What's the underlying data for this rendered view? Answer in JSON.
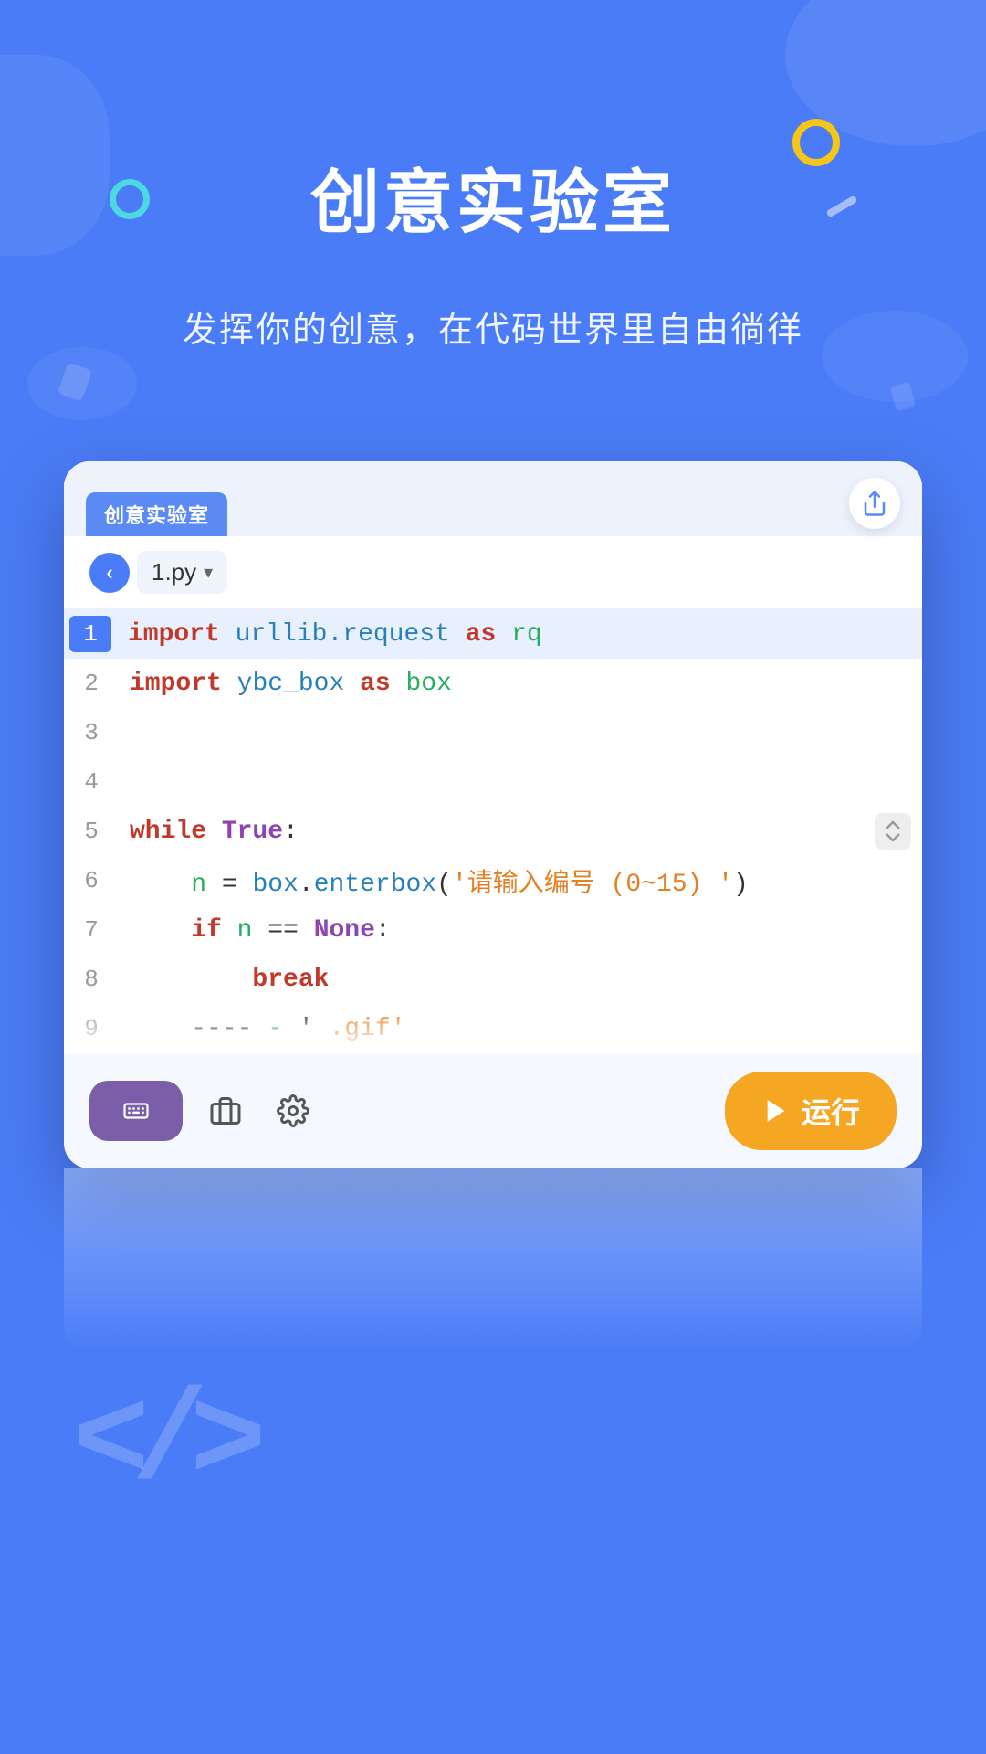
{
  "page": {
    "title": "创意实验室",
    "subtitle": "发挥你的创意，在代码世界里自由徜徉",
    "background_color": "#4a7cf7"
  },
  "editor": {
    "tab_label": "创意实验室",
    "file_name": "1.py",
    "share_label": "⬆",
    "run_label": "运行",
    "keyboard_icon": "⌨",
    "back_icon": "‹"
  },
  "code_lines": [
    {
      "number": "1",
      "active": true,
      "content": "import urllib.request as rq"
    },
    {
      "number": "2",
      "active": false,
      "content": "import ybc_box as box"
    },
    {
      "number": "3",
      "active": false,
      "content": ""
    },
    {
      "number": "4",
      "active": false,
      "content": ""
    },
    {
      "number": "5",
      "active": false,
      "content": "while True:"
    },
    {
      "number": "6",
      "active": false,
      "content": "    n = box.enterbox('请输入编号 (0~15) ')"
    },
    {
      "number": "7",
      "active": false,
      "content": "    if n == None:"
    },
    {
      "number": "8",
      "active": false,
      "content": "        break"
    },
    {
      "number": "9",
      "active": false,
      "content": "    ----  -  '  .gif'"
    }
  ],
  "tools": {
    "briefcase_icon": "briefcase",
    "settings_icon": "settings"
  }
}
